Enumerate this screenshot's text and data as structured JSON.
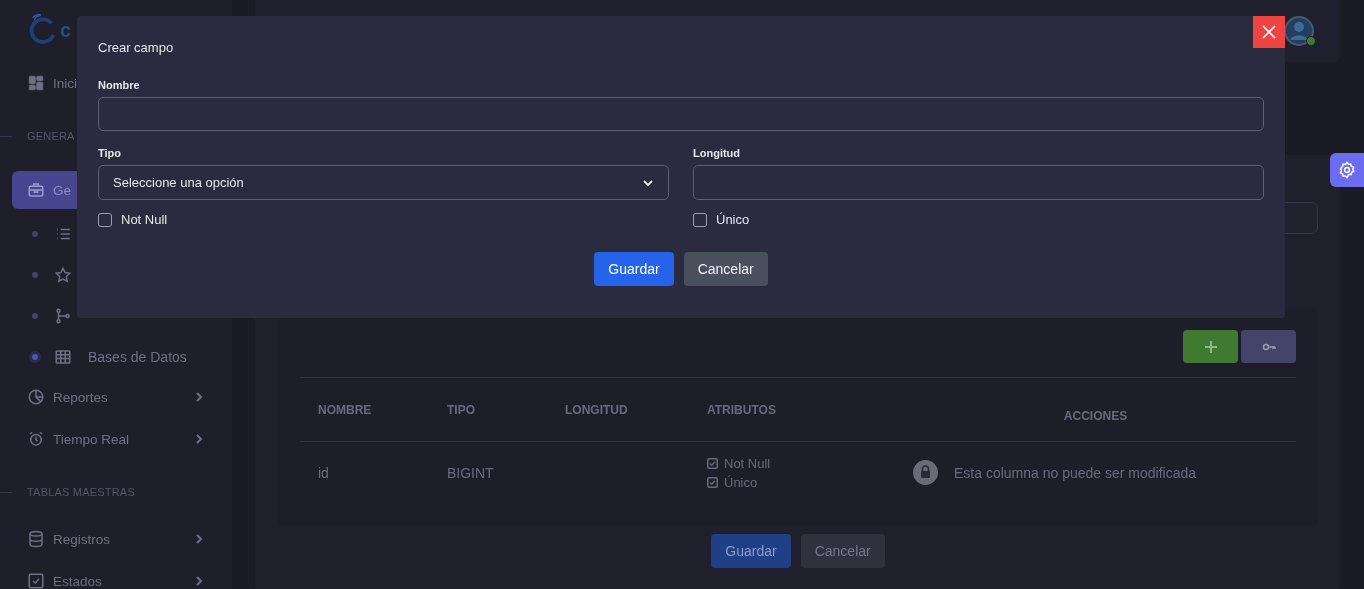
{
  "sidebar": {
    "logo_text": "c",
    "items": [
      {
        "kind": "link",
        "label": "Inici",
        "selected": false
      },
      {
        "kind": "section",
        "label": "GENERA"
      },
      {
        "kind": "link",
        "label": "Ge",
        "selected": true
      },
      {
        "kind": "sub",
        "selected": false
      },
      {
        "kind": "sub",
        "selected": false
      },
      {
        "kind": "sub",
        "selected": false
      },
      {
        "kind": "sub",
        "label": "Bases de Datos",
        "selected": true
      },
      {
        "kind": "link",
        "label": "Reportes",
        "selected": false,
        "expandable": true
      },
      {
        "kind": "link",
        "label": "Tiempo Real",
        "selected": false,
        "expandable": true
      },
      {
        "kind": "section",
        "label": "TABLAS MAESTRAS"
      },
      {
        "kind": "link",
        "label": "Registros",
        "selected": false,
        "expandable": true
      },
      {
        "kind": "link",
        "label": "Estados",
        "selected": false,
        "expandable": true
      }
    ]
  },
  "header": {
    "user": {
      "online": true
    }
  },
  "table": {
    "columns": [
      "NOMBRE",
      "TIPO",
      "LONGITUD",
      "ATRIBUTOS",
      "ACCIONES"
    ],
    "rows": [
      {
        "nombre": "id",
        "tipo": "BIGINT",
        "atributos": [
          {
            "label": "Not Null",
            "checked": true
          },
          {
            "label": "Único",
            "checked": true
          }
        ],
        "acciones": "Esta columna no puede ser modificada",
        "locked": true
      }
    ]
  },
  "form_buttons": [
    {
      "label": "Guardar",
      "kind": "primary"
    },
    {
      "label": "Cancelar",
      "kind": "secondary"
    }
  ],
  "dialog": {
    "title": "Crear campo",
    "name_field": {
      "label": "Nombre"
    },
    "type_field": {
      "label": "Tipo",
      "value": "Seleccione una opción"
    },
    "length_field": {
      "label": "Longitud"
    },
    "checkboxes": [
      {
        "label": "Not Null",
        "checked": false
      },
      {
        "label": "Único",
        "checked": false
      }
    ],
    "buttons": [
      {
        "label": "Guardar",
        "kind": "primary"
      },
      {
        "label": "Cancelar",
        "kind": "secondary"
      }
    ]
  }
}
